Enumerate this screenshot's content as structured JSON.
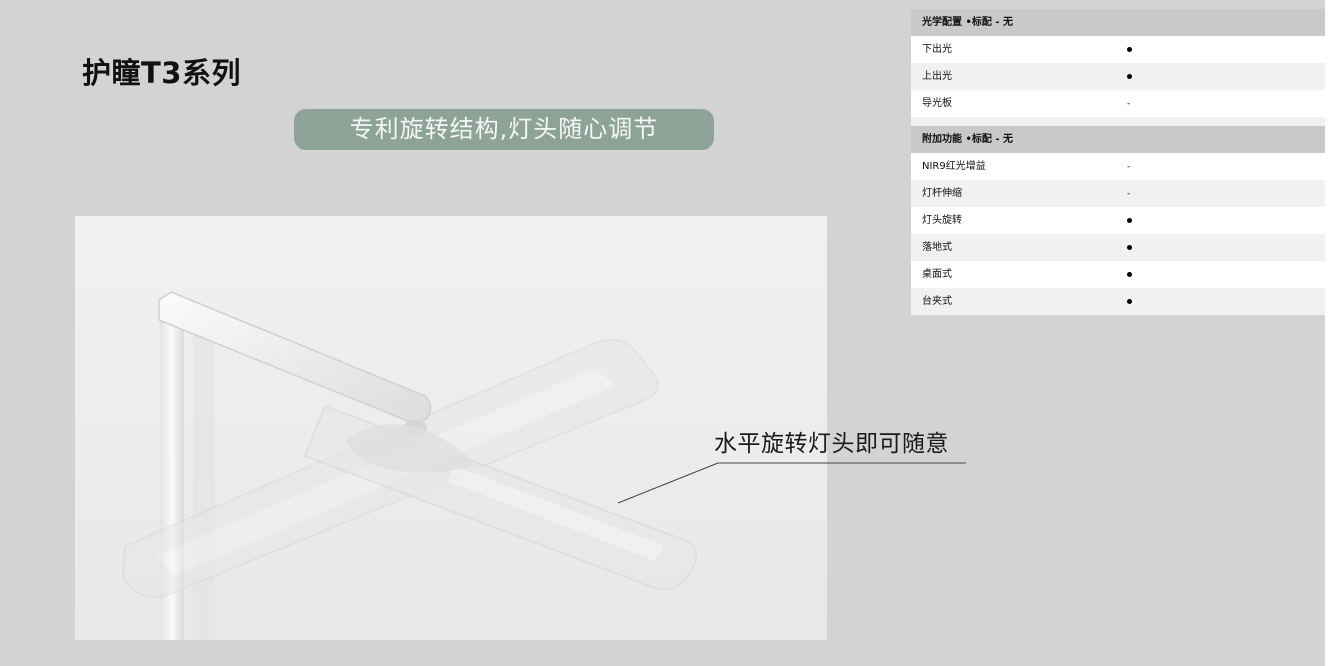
{
  "series_title": "护瞳T3系列",
  "tagline": "专利旋转结构,灯头随心调节",
  "callout": "水平旋转灯头即可随意",
  "spec_table": {
    "optical": {
      "header": "光学配置 •标配  - 无",
      "rows": [
        {
          "name": "下出光",
          "value": "•"
        },
        {
          "name": "上出光",
          "value": "•"
        },
        {
          "name": "导光板",
          "value": "-"
        }
      ]
    },
    "features": {
      "header": "附加功能  •标配  - 无",
      "rows": [
        {
          "name": "NIR9红光增益",
          "value": "-"
        },
        {
          "name": "灯杆伸缩",
          "value": "-"
        },
        {
          "name": "灯头旋转",
          "value": "•"
        },
        {
          "name": "落地式",
          "value": "•"
        },
        {
          "name": "桌面式",
          "value": "•"
        },
        {
          "name": "台夹式",
          "value": "•"
        }
      ]
    }
  },
  "colors": {
    "background": "#d3d3d3",
    "pill": "#8ea397",
    "header_row": "#c9c9c9"
  }
}
